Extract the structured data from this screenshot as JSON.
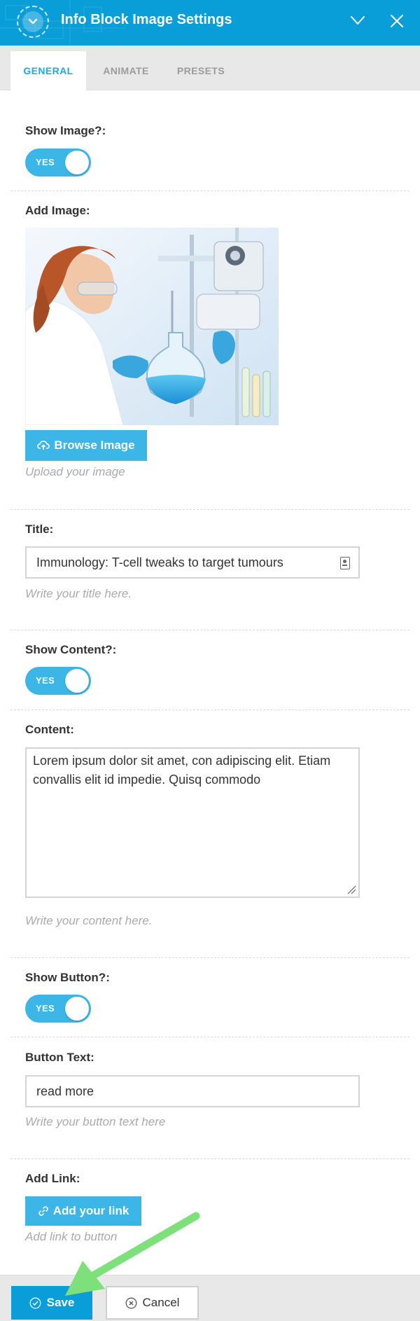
{
  "header": {
    "title": "Info Block Image Settings",
    "background_color": "#0a9ed8",
    "icons": [
      "chevron-down-icon",
      "check-icon",
      "close-icon"
    ]
  },
  "tabs": [
    {
      "label": "GENERAL",
      "active": true
    },
    {
      "label": "ANIMATE",
      "active": false
    },
    {
      "label": "PRESETS",
      "active": false
    }
  ],
  "fields": {
    "show_image": {
      "label": "Show Image?:",
      "toggle_text": "YES",
      "value": true
    },
    "add_image": {
      "label": "Add Image:",
      "browse_label": "Browse Image",
      "help": "Upload your image",
      "icon": "cloud-upload-icon"
    },
    "title": {
      "label": "Title:",
      "value": "Immunology: T-cell tweaks to target tumours",
      "help": "Write your title here."
    },
    "show_content": {
      "label": "Show Content?:",
      "toggle_text": "YES",
      "value": true
    },
    "content": {
      "label": "Content:",
      "value": "Lorem ipsum dolor sit amet, con adipiscing elit. Etiam convallis elit id impedie. Quisq commodo",
      "help": "Write your content here."
    },
    "show_button": {
      "label": "Show Button?:",
      "toggle_text": "YES",
      "value": true
    },
    "button_text": {
      "label": "Button Text:",
      "value": "read more",
      "help": "Write your button text here"
    },
    "add_link": {
      "label": "Add Link:",
      "button_label": "Add your link",
      "help": "Add link to button",
      "icon": "link-icon"
    }
  },
  "footer": {
    "save_label": "Save",
    "cancel_label": "Cancel"
  },
  "colors": {
    "accent": "#3bb6e6",
    "primary": "#0a9ed8",
    "annotation_arrow": "#7ee07a"
  }
}
